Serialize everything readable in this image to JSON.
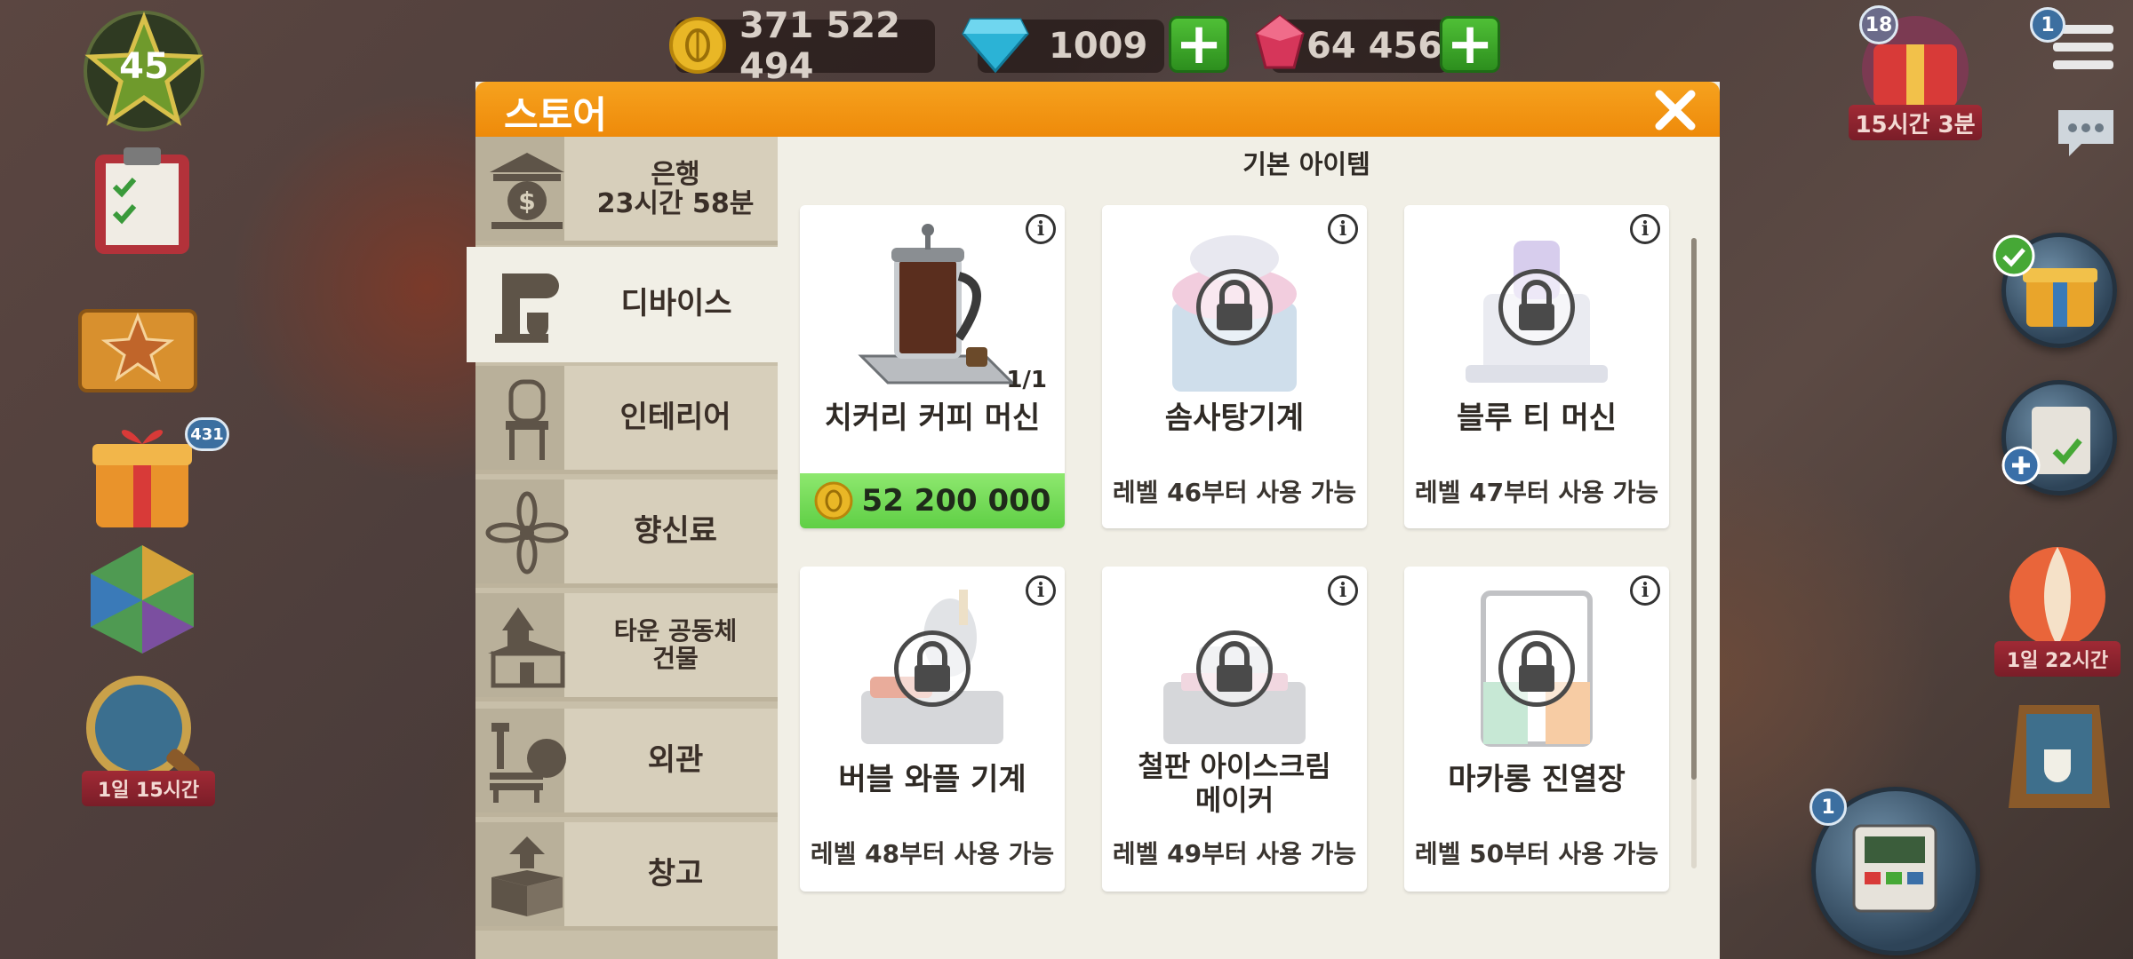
{
  "hud": {
    "level": "45",
    "coins": "371 522 494",
    "diamonds": "1009",
    "rubies": "64 456",
    "left_event_timer": "1일 15시간",
    "left_gift_badge": "431",
    "top_right_gift_badge": "18",
    "top_right_gift_timer": "15시간 3분",
    "menu_badge": "1",
    "balloon_timer": "1일 22시간",
    "register_badge": "1"
  },
  "store": {
    "title": "스토어",
    "section_title": "기본 아이템",
    "categories": [
      {
        "label": "은행\n23시간 58분",
        "icon": "bank-icon"
      },
      {
        "label": "디바이스",
        "icon": "coffee-machine-icon"
      },
      {
        "label": "인테리어",
        "icon": "chair-icon"
      },
      {
        "label": "향신료",
        "icon": "star-anise-icon"
      },
      {
        "label": "타운 공동체\n건물",
        "icon": "building-icon"
      },
      {
        "label": "외관",
        "icon": "bench-icon"
      },
      {
        "label": "창고",
        "icon": "box-icon"
      }
    ],
    "items": [
      {
        "name": "치커리 커피 머신",
        "count": "1/1",
        "price": "52 200 000"
      },
      {
        "name": "솜사탕기계",
        "req": "레벨 46부터 사용 가능"
      },
      {
        "name": "블루 티 머신",
        "req": "레벨 47부터 사용 가능"
      },
      {
        "name": "버블 와플 기계",
        "req": "레벨 48부터 사용 가능"
      },
      {
        "name": "철판 아이스크림\n메이커",
        "req": "레벨 49부터 사용 가능"
      },
      {
        "name": "마카롱 진열장",
        "req": "레벨 50부터 사용 가능"
      }
    ]
  },
  "colors": {
    "header_orange": "#f29614",
    "price_green": "#6ed853",
    "panel_bg": "#f1efe6"
  }
}
